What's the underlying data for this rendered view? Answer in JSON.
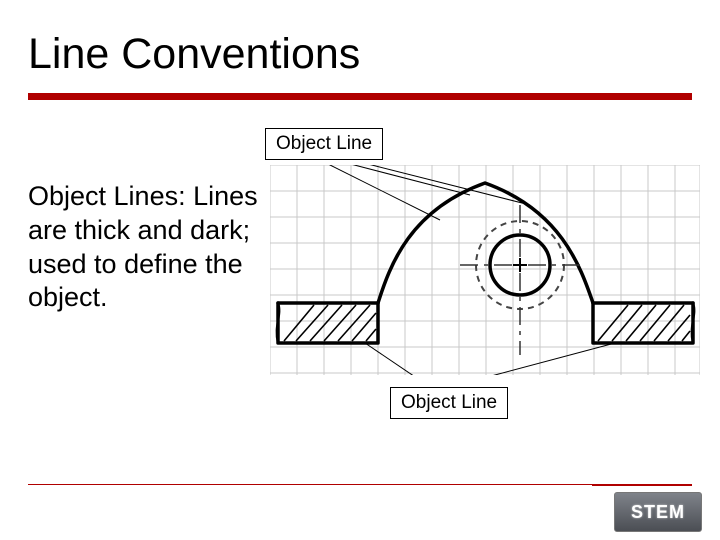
{
  "title": "Line Conventions",
  "labels": {
    "top": "Object Line",
    "bottom": "Object Line"
  },
  "body": "Object Lines: Lines are thick and dark; used to define the object.",
  "logo": {
    "text": "STEM"
  }
}
